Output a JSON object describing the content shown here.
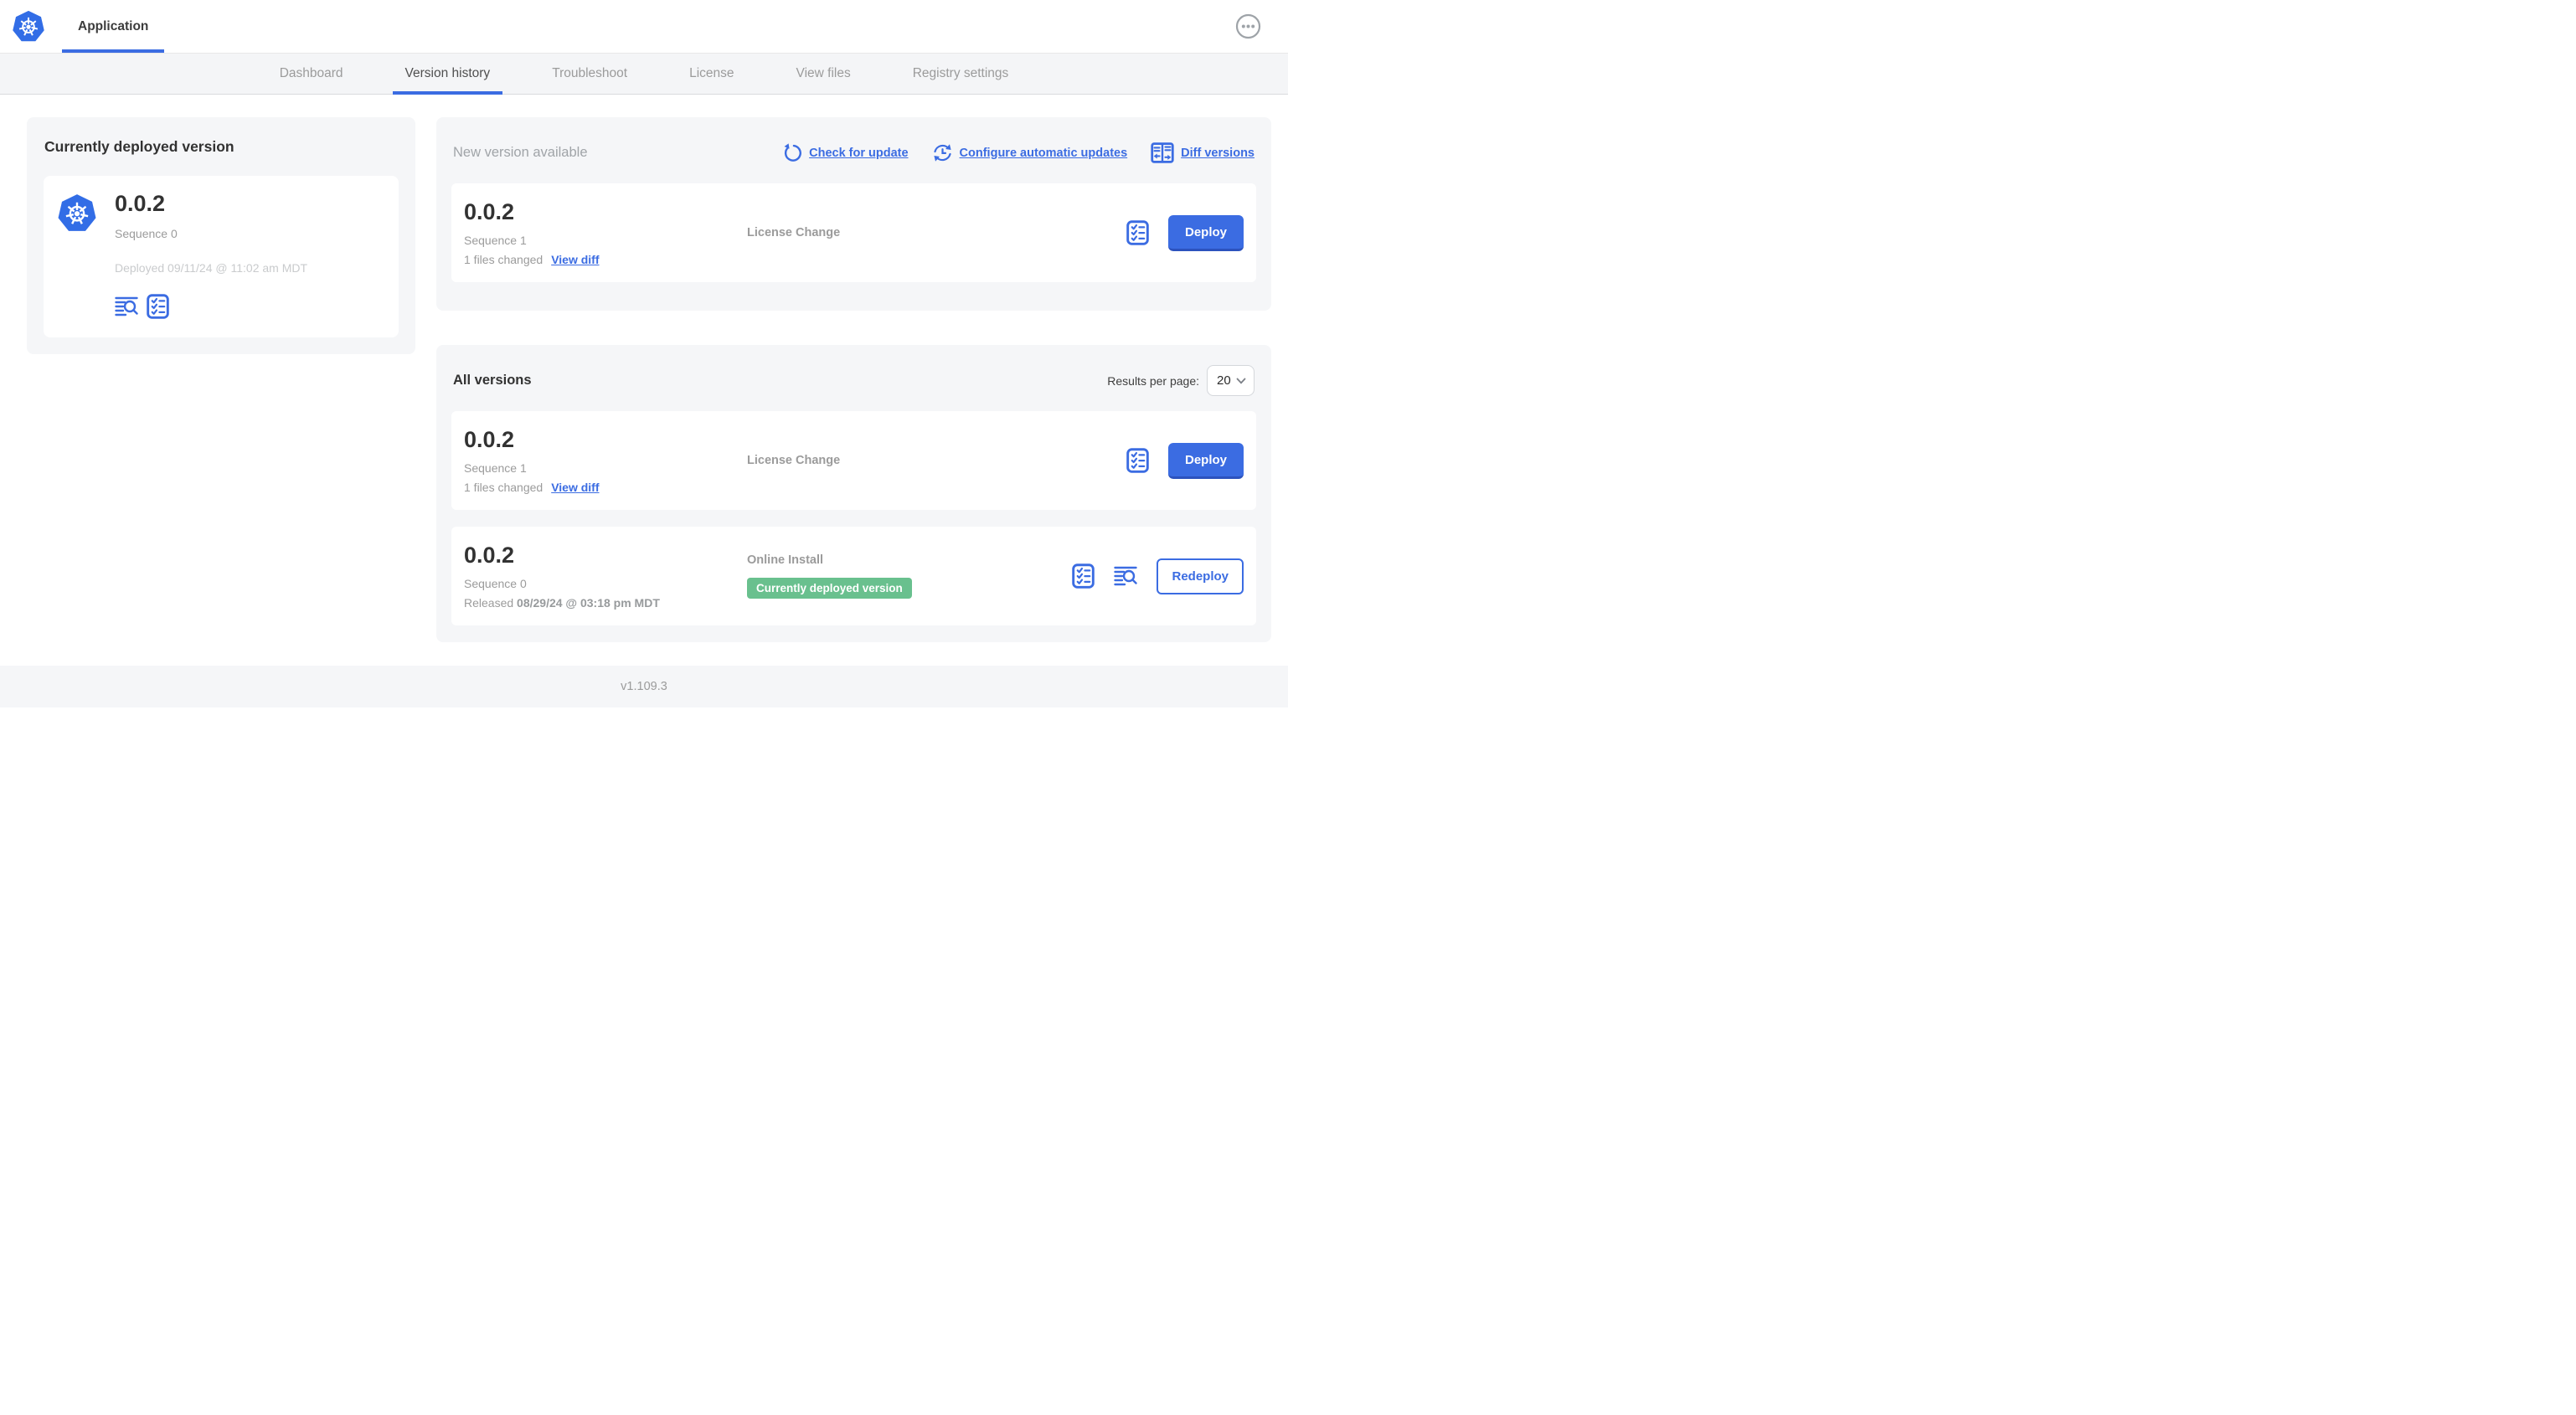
{
  "topbar": {
    "app_tab": "Application"
  },
  "nav": {
    "active_tab": "Version history",
    "tabs": [
      {
        "label": "Dashboard"
      },
      {
        "label": "Version history"
      },
      {
        "label": "Troubleshoot"
      },
      {
        "label": "License"
      },
      {
        "label": "View files"
      },
      {
        "label": "Registry settings"
      }
    ]
  },
  "current_version": {
    "title": "Currently deployed version",
    "version": "0.0.2",
    "sequence": "Sequence 0",
    "deployed": "Deployed 09/11/24 @ 11:02 am MDT"
  },
  "new_version": {
    "title": "New version available",
    "actions": {
      "check": "Check for update",
      "configure": "Configure automatic updates",
      "diff": "Diff versions"
    },
    "row": {
      "version": "0.0.2",
      "sequence": "Sequence 1",
      "files_changed": "1 files changed",
      "view_diff": "View diff",
      "source": "License Change",
      "action_label": "Deploy"
    }
  },
  "all_versions": {
    "title": "All versions",
    "results_per_page_label": "Results per page:",
    "results_per_page_value": "20",
    "rows": [
      {
        "version": "0.0.2",
        "sequence": "Sequence 1",
        "files_changed": "1 files changed",
        "view_diff": "View diff",
        "source": "License Change",
        "action_label": "Deploy"
      },
      {
        "version": "0.0.2",
        "sequence": "Sequence 0",
        "released_label": "Released",
        "released_date": "08/29/24 @ 03:18 pm MDT",
        "source": "Online Install",
        "badge": "Currently deployed version",
        "action_label": "Redeploy"
      }
    ]
  },
  "footer": {
    "app_version": "v1.109.3"
  },
  "icons": [
    "kubernetes-logo-icon",
    "ellipsis-menu-icon",
    "refresh-icon",
    "auto-update-clock-icon",
    "diff-versions-icon",
    "view-logs-icon",
    "preflight-checklist-icon",
    "chevron-down-icon"
  ],
  "colors": {
    "primary_blue": "#3b6ce2",
    "kubernetes_blue": "#326DE6",
    "badge_green": "#69c08e",
    "card_background": "#f5f6f8",
    "muted_text": "#9b9b9b"
  }
}
